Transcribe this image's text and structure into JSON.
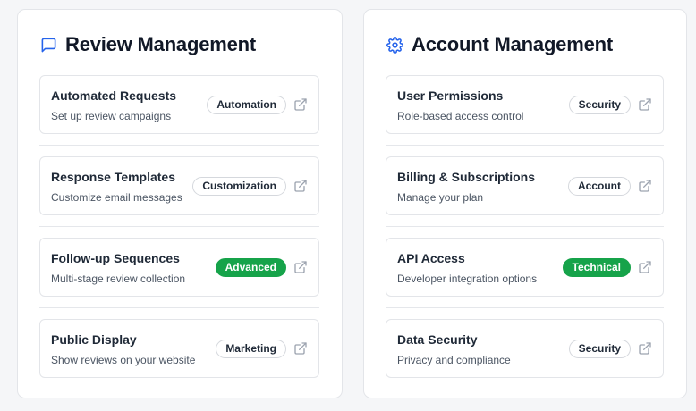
{
  "colors": {
    "accent": "#2563eb",
    "green_badge": "#16a34a",
    "muted": "#9ca3af"
  },
  "panels": [
    {
      "title": "Review Management",
      "icon": "message-square-icon",
      "items": [
        {
          "title": "Automated Requests",
          "subtitle": "Set up review campaigns",
          "badge": "Automation",
          "badge_style": "outline"
        },
        {
          "title": "Response Templates",
          "subtitle": "Customize email messages",
          "badge": "Customization",
          "badge_style": "outline"
        },
        {
          "title": "Follow-up Sequences",
          "subtitle": "Multi-stage review collection",
          "badge": "Advanced",
          "badge_style": "green"
        },
        {
          "title": "Public Display",
          "subtitle": "Show reviews on your website",
          "badge": "Marketing",
          "badge_style": "outline"
        }
      ]
    },
    {
      "title": "Account Management",
      "icon": "gear-icon",
      "items": [
        {
          "title": "User Permissions",
          "subtitle": "Role-based access control",
          "badge": "Security",
          "badge_style": "outline"
        },
        {
          "title": "Billing & Subscriptions",
          "subtitle": "Manage your plan",
          "badge": "Account",
          "badge_style": "outline"
        },
        {
          "title": "API Access",
          "subtitle": "Developer integration options",
          "badge": "Technical",
          "badge_style": "green"
        },
        {
          "title": "Data Security",
          "subtitle": "Privacy and compliance",
          "badge": "Security",
          "badge_style": "outline"
        }
      ]
    }
  ]
}
